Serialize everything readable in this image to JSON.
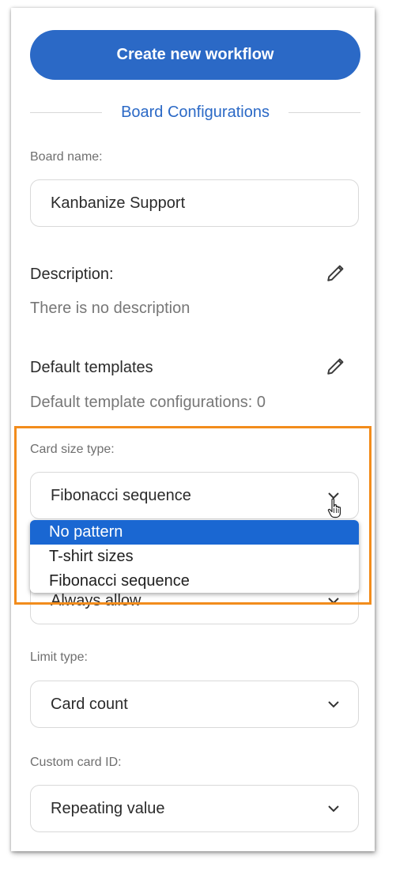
{
  "actions": {
    "create_workflow_label": "Create new workflow"
  },
  "section": {
    "title": "Board Configurations"
  },
  "board_name": {
    "label": "Board name:",
    "value": "Kanbanize Support"
  },
  "description": {
    "heading": "Description:",
    "text": "There is no description"
  },
  "default_templates": {
    "heading": "Default templates",
    "text": "Default template configurations: 0"
  },
  "card_size_type": {
    "label": "Card size type:",
    "value": "Fibonacci sequence",
    "options": [
      "No pattern",
      "T-shirt sizes",
      "Fibonacci sequence"
    ],
    "highlighted_option": "No pattern"
  },
  "hidden_field": {
    "value": "Always allow"
  },
  "limit_type": {
    "label": "Limit type:",
    "value": "Card count"
  },
  "custom_card_id": {
    "label": "Custom card ID:",
    "value": "Repeating value"
  },
  "colors": {
    "accent": "#2b69c6",
    "option_selected": "#1a67d2",
    "highlight_border": "#f28c1c"
  },
  "icons": {
    "edit": "pencil-icon",
    "dropdown": "chevron-down-icon",
    "cursor": "hand-pointer-icon"
  }
}
